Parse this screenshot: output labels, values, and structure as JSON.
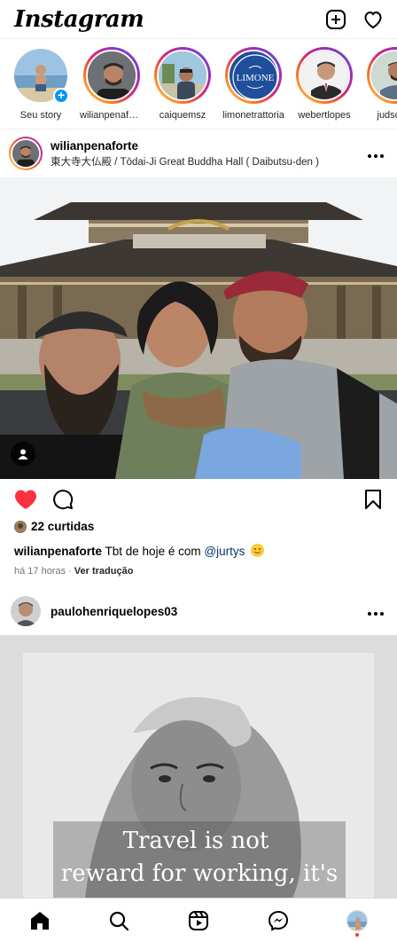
{
  "app": {
    "logo_text": "Instagram",
    "icons": {
      "new_post": "plus-square-icon",
      "activity": "heart-icon"
    }
  },
  "stories": [
    {
      "name": "Seu story",
      "own": true
    },
    {
      "name": "wilianpenaforte",
      "own": false
    },
    {
      "name": "caiquemsz",
      "own": false
    },
    {
      "name": "limonetrattoria",
      "own": false
    },
    {
      "name": "webertlopes",
      "own": false
    },
    {
      "name": "judson.s",
      "own": false
    }
  ],
  "post1": {
    "username": "wilianpenaforte",
    "location": "東大寺大仏殿 / Tōdai-Ji Great Buddha Hall ( Daibutsu-den )",
    "likes": "22 curtidas",
    "caption_user": "wilianpenaforte",
    "caption_text": "Tbt de hoje é com",
    "caption_mention": "@jurtys",
    "time": "há 17 horas",
    "translate": "Ver tradução"
  },
  "post2": {
    "username": "paulohenriquelopes03",
    "image_text_line1": "Travel is not",
    "image_text_line2": "reward for working, it's"
  },
  "colors": {
    "like_red": "#ff3040",
    "link_blue": "#0095f6",
    "mention": "#00376b"
  }
}
